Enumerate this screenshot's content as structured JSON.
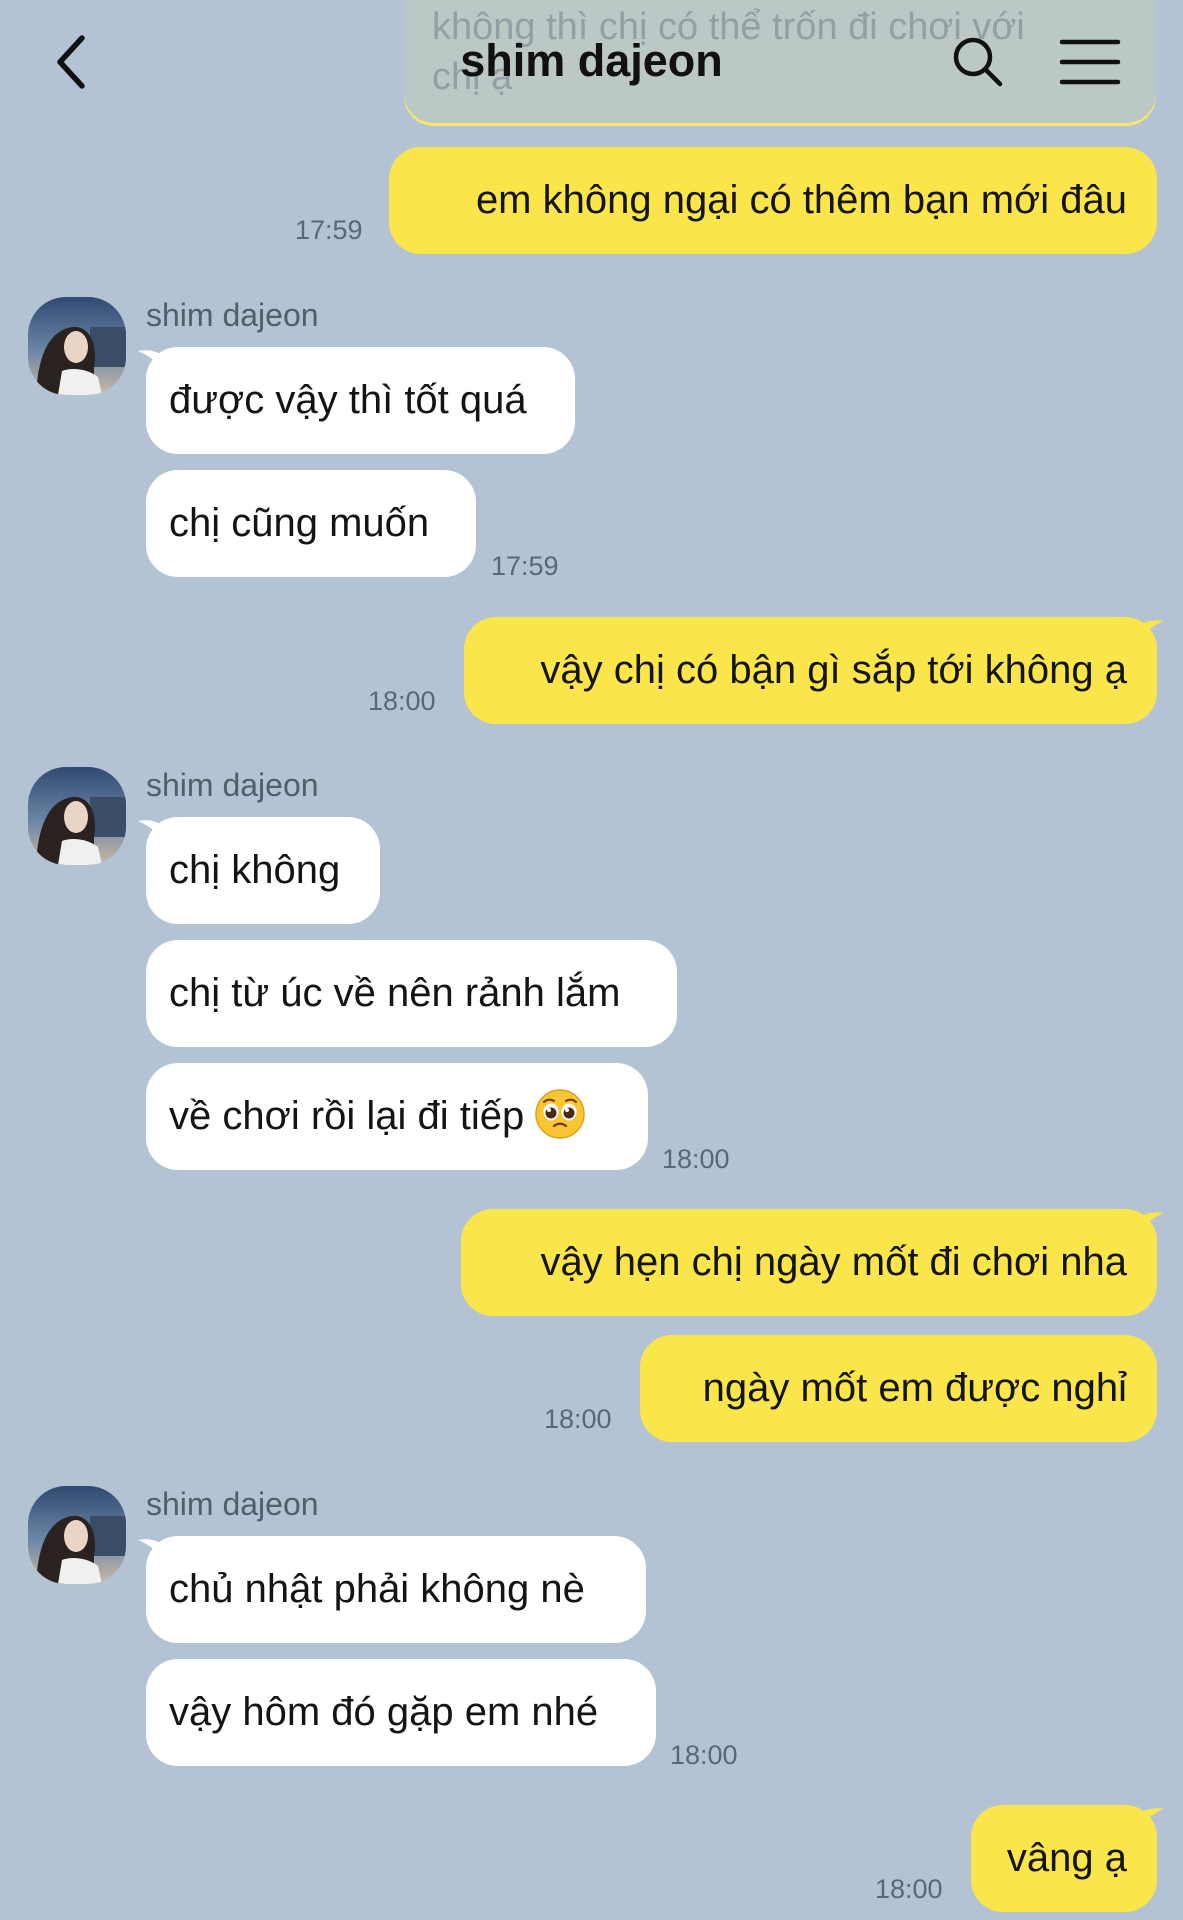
{
  "header": {
    "title": "shim dajeon"
  },
  "faded_message": {
    "text_line1": "không thì chị có thể trốn đi chơi với",
    "text_line2": "chị ạ"
  },
  "messages": {
    "m1": {
      "text": "em không ngại có thêm bạn mới đâu",
      "time": "17:59"
    },
    "g1": {
      "sender": "shim dajeon",
      "b1": "được vậy thì tốt quá",
      "b2": "chị cũng muốn",
      "time": "17:59"
    },
    "m2": {
      "text": "vậy chị có bận gì sắp tới không ạ",
      "time": "18:00"
    },
    "g2": {
      "sender": "shim dajeon",
      "b1": "chị không",
      "b2": "chị từ úc về nên rảnh lắm",
      "b3": "về chơi rồi lại đi tiếp",
      "b3_emoji": "pleading-face-emoji",
      "time": "18:00"
    },
    "m3": {
      "b1": "vậy hẹn chị ngày mốt đi chơi nha",
      "b2": "ngày mốt em được nghỉ",
      "time": "18:00"
    },
    "g3": {
      "sender": "shim dajeon",
      "b1": "chủ nhật phải không nè",
      "b2": "vậy hôm đó gặp em nhé",
      "time": "18:00"
    },
    "m4": {
      "text": "vâng ạ",
      "time": "18:00"
    }
  },
  "colors": {
    "background": "#b3c3d3",
    "my_bubble": "#fae64b",
    "their_bubble": "#ffffff",
    "timestamp": "#596876"
  },
  "icons": {
    "back": "chevron-left-icon",
    "search": "search-icon",
    "menu": "hamburger-menu-icon"
  }
}
